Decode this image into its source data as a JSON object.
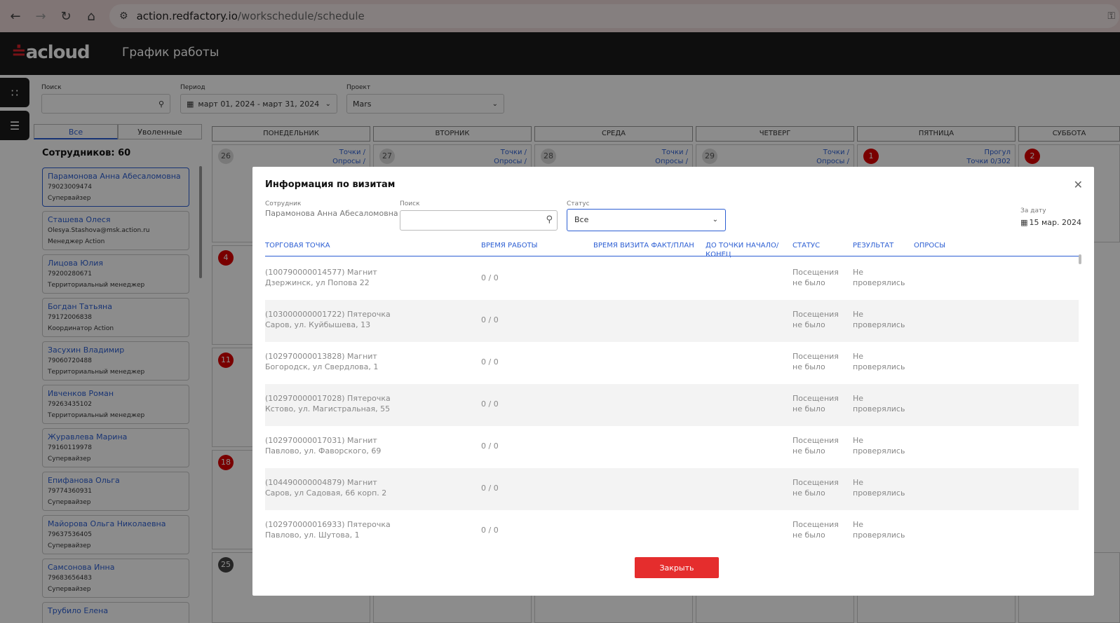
{
  "browser": {
    "url_host": "action.redfactory.io",
    "url_path": "/workschedule/schedule"
  },
  "app": {
    "logo": "acloud",
    "title": "График работы"
  },
  "filters": {
    "search_label": "Поиск",
    "period_label": "Период",
    "period_value": "март 01, 2024 - март 31, 2024",
    "project_label": "Проект",
    "project_value": "Mars"
  },
  "tabs": [
    "Все",
    "Уволенные"
  ],
  "employee_count": "Сотрудников: 60",
  "employees": [
    {
      "name": "Парамонова Анна Абесаломовна",
      "contact": "79023009474",
      "role": "Супервайзер"
    },
    {
      "name": "Сташева Олеся",
      "contact": "Olesya.Stashova@msk.action.ru",
      "role": "Менеджер Action"
    },
    {
      "name": "Лицова Юлия",
      "contact": "79200280671",
      "role": "Территориальный менеджер"
    },
    {
      "name": "Богдан Татьяна",
      "contact": "79172006838",
      "role": "Координатор Action"
    },
    {
      "name": "Засухин Владимир",
      "contact": "79060720488",
      "role": "Территориальный менеджер"
    },
    {
      "name": "Ивченков Роман",
      "contact": "79263435102",
      "role": "Территориальный менеджер"
    },
    {
      "name": "Журавлева Марина",
      "contact": "79160119978",
      "role": "Супервайзер"
    },
    {
      "name": "Епифанова Ольга",
      "contact": "79774360931",
      "role": "Супервайзер"
    },
    {
      "name": "Майорова Ольга Николаевна",
      "contact": "79637536405",
      "role": "Супервайзер"
    },
    {
      "name": "Самсонова Инна",
      "contact": "79683656483",
      "role": "Супервайзер"
    },
    {
      "name": "Трубило Елена",
      "contact": "",
      "role": ""
    }
  ],
  "calendar": {
    "days": [
      "ПОНЕДЕЛЬНИК",
      "ВТОРНИК",
      "СРЕДА",
      "ЧЕТВЕРГ",
      "ПЯТНИЦА",
      "СУББОТА"
    ],
    "first_row": [
      "26",
      "27",
      "28",
      "29",
      "1",
      "2"
    ],
    "cell_link_1": "Точки /",
    "cell_link_2": "Опросы /",
    "fri_link_1": "Прогул",
    "fri_link_2": "Точки 0/302",
    "monday_dates": [
      "4",
      "11",
      "18",
      "25"
    ]
  },
  "modal": {
    "title": "Информация по визитам",
    "employee_label": "Сотрудник",
    "employee_value": "Парамонова Анна Абесаломовна",
    "search_label": "Поиск",
    "status_label": "Статус",
    "status_value": "Все",
    "date_label": "За дату",
    "date_value": "15 мар. 2024",
    "columns": [
      "ТОРГОВАЯ ТОЧКА",
      "ВРЕМЯ РАБОТЫ",
      "ВРЕМЯ ВИЗИТА ФАКТ/ПЛАН",
      "ДО ТОЧКИ НАЧАЛО/ КОНЕЦ",
      "СТАТУС",
      "РЕЗУЛЬТАТ",
      "ОПРОСЫ"
    ],
    "rows": [
      {
        "point1": "(100790000014577) Магнит",
        "point2": "Дзержинск, ул Попова 22",
        "time": "0 / 0",
        "status1": "Посещения",
        "status2": "не было",
        "result1": "Не",
        "result2": "проверялись"
      },
      {
        "point1": "(103000000001722) Пятерочка",
        "point2": "Саров, ул. Куйбышева, 13",
        "time": "0 / 0",
        "status1": "Посещения",
        "status2": "не было",
        "result1": "Не",
        "result2": "проверялись"
      },
      {
        "point1": "(102970000013828) Магнит",
        "point2": "Богородск, ул Свердлова, 1",
        "time": "0 / 0",
        "status1": "Посещения",
        "status2": "не было",
        "result1": "Не",
        "result2": "проверялись"
      },
      {
        "point1": "(102970000017028) Пятерочка",
        "point2": "Кстово, ул. Магистральная, 55",
        "time": "0 / 0",
        "status1": "Посещения",
        "status2": "не было",
        "result1": "Не",
        "result2": "проверялись"
      },
      {
        "point1": "(102970000017031) Магнит",
        "point2": "Павлово, ул. Фаворского, 69",
        "time": "0 / 0",
        "status1": "Посещения",
        "status2": "не было",
        "result1": "Не",
        "result2": "проверялись"
      },
      {
        "point1": "(104490000004879) Магнит",
        "point2": "Саров, ул Садовая, 66 корп. 2",
        "time": "0 / 0",
        "status1": "Посещения",
        "status2": "не было",
        "result1": "Не",
        "result2": "проверялись"
      },
      {
        "point1": "(102970000016933) Пятерочка",
        "point2": "Павлово, ул. Шутова, 1",
        "time": "0 / 0",
        "status1": "Посещения",
        "status2": "не было",
        "result1": "Не",
        "result2": "проверялись"
      }
    ],
    "close_label": "Закрыть"
  }
}
